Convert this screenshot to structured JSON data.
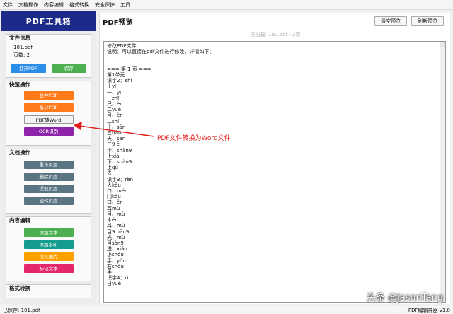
{
  "menubar": {
    "items": [
      "文件",
      "文档操作",
      "内容编辑",
      "格式转换",
      "安全保护",
      "工具"
    ]
  },
  "sidebar": {
    "app_title": "PDF工具箱",
    "file_info": {
      "title": "文件信息",
      "filename": "101.pdf",
      "pages": "页数: 2",
      "open_btn": "打开PDF",
      "save_btn": "保存"
    },
    "quick_ops": {
      "title": "快速操作",
      "merge": "合并PDF",
      "split": "拆分PDF",
      "to_word": "PDF转Word",
      "ocr": "OCR识别"
    },
    "doc_ops": {
      "title": "文档操作",
      "reorder": "重排页面",
      "delete": "删除页面",
      "extract": "提取页面",
      "rotate": "旋转页面"
    },
    "content_edit": {
      "title": "内容编辑",
      "add_text": "添加文本",
      "add_watermark": "添加水印",
      "insert_image": "插入图片",
      "annotate": "标记文本"
    },
    "format_convert": {
      "title": "格式转换"
    }
  },
  "main": {
    "title": "PDF预览",
    "clear_btn": "清空预览",
    "refresh_btn": "刷新预览",
    "loaded": "已加载: 100.pdf - 2页",
    "text": "修改PDF文件\n说明：可以直接在pdf文件进行修改，详情如下：\n\n\n=== 第 1 页 ===\n第1单元\n识字2：shí\n十yī\n一、yī\n一zhī\n只、èr\n二yuè\n月、èr\n二shí\n十、sān\n三tiān\n天、sān\n三9 ē\n个、shàn9\n上xià\n下、shàn9\n上qù\n去\n识字3：rèn\n人kǒu\n口、mén\n门kǒu\n口、ěr\n耳mù\n目、mù\n木ěr\n耳、mù\n目9 uān9\n光、mù\n目sòn9\n送、xiǎo\n小shǒu\n手、yǒu\n右shǒu\n手\n识字4：rì\n日yuè"
  },
  "annotation": "PDF文件转换为Word文件",
  "statusbar": {
    "left": "已保存: 101.pdf",
    "right": "PDF编辑神器 v1.0"
  },
  "watermark": "头条 @JasonTang",
  "colors": {
    "title_bar": "#1c2a8a",
    "annotation": "#e51c1c"
  }
}
